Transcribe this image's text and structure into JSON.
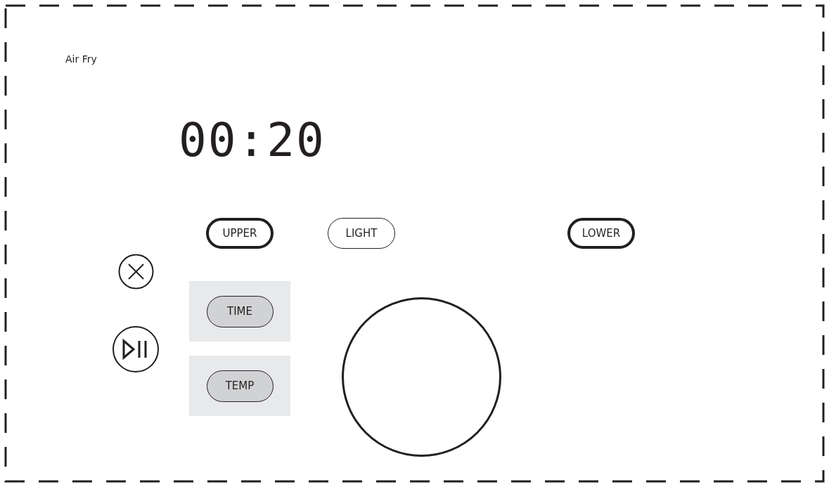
{
  "mode_label": "Air Fry",
  "display": "00:20",
  "heat_buttons": [
    {
      "label": "UPPER",
      "on": true
    },
    {
      "label": "LIGHT",
      "on": false
    },
    {
      "label": "LOWER",
      "on": true
    }
  ],
  "setting_buttons": [
    {
      "label": "TIME",
      "selected": true
    },
    {
      "label": "TEMP",
      "selected": true
    }
  ]
}
